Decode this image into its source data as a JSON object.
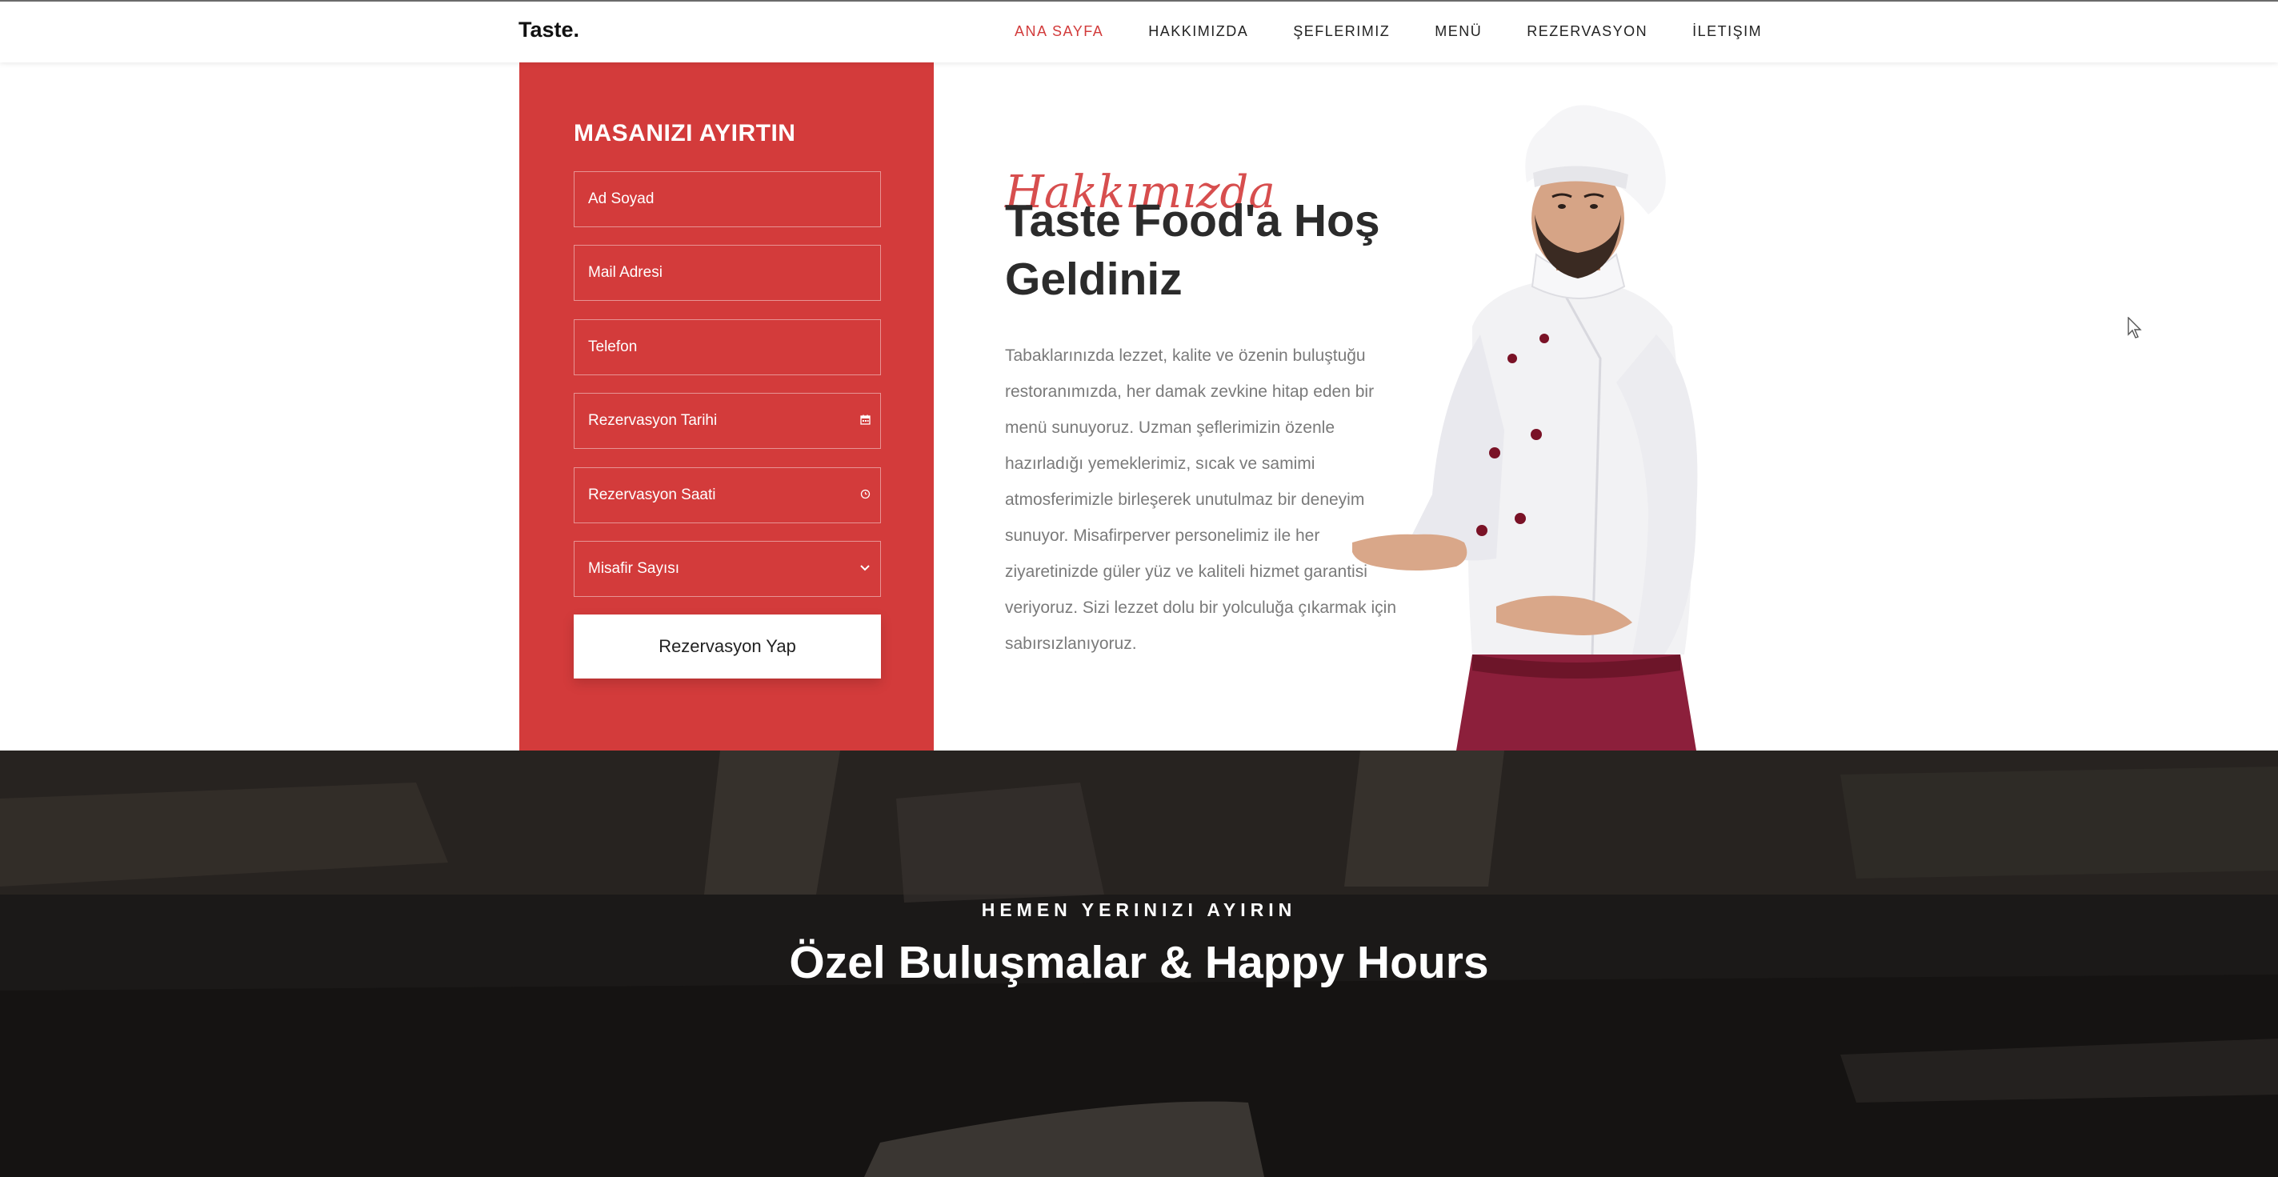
{
  "navbar": {
    "brand": "Taste.",
    "items": [
      {
        "label": "ANA SAYFA",
        "active": true
      },
      {
        "label": "HAKKIMIZDA",
        "active": false
      },
      {
        "label": "ŞEFLERIMIZ",
        "active": false
      },
      {
        "label": "MENÜ",
        "active": false
      },
      {
        "label": "REZERVASYON",
        "active": false
      },
      {
        "label": "İLETIŞIM",
        "active": false
      }
    ]
  },
  "booking": {
    "title": "MASANIZI AYIRTIN",
    "fields": [
      {
        "placeholder": "Ad Soyad",
        "icon": ""
      },
      {
        "placeholder": "Mail Adresi",
        "icon": ""
      },
      {
        "placeholder": "Telefon",
        "icon": ""
      },
      {
        "placeholder": "Rezervasyon Tarihi",
        "icon": "calendar-icon"
      },
      {
        "placeholder": "Rezervasyon Saati",
        "icon": "clock-icon"
      },
      {
        "placeholder": "Misafir Sayısı",
        "icon": "chevron-down-icon"
      }
    ],
    "submit_label": "Rezervasyon Yap"
  },
  "about": {
    "script_label": "Hakkımızda",
    "title": "Taste Food'a Hoş Geldiniz",
    "text": "Tabaklarınızda lezzet, kalite ve özenin buluştuğu restoranımızda, her damak zevkine hitap eden bir menü sunuyoruz. Uzman şeflerimizin özenle hazırladığı yemeklerimiz, sıcak ve samimi atmosferimizle birleşerek unutulmaz bir deneyim sunuyor. Misafirperver personelimiz ile her ziyaretinizde güler yüz ve kaliteli hizmet garantisi veriyoruz. Sizi lezzet dolu bir yolculuğa çıkarmak için sabırsızlanıyoruz."
  },
  "promo": {
    "eyebrow": "HEMEN YERINIZI AYIRIN",
    "title": "Özel Buluşmalar & Happy Hours"
  },
  "colors": {
    "accent": "#d33b3b",
    "dark_bg": "#1e1c1a",
    "text_muted": "#7a7a7a"
  }
}
